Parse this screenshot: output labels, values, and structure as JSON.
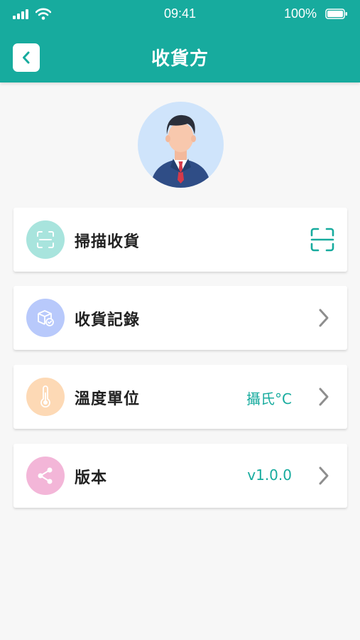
{
  "status_bar": {
    "time": "09:41",
    "battery": "100%",
    "icons": [
      "signal-icon",
      "wifi-icon",
      "battery-icon"
    ]
  },
  "header": {
    "title": "收貨方",
    "back_icon": "chevron-left-icon"
  },
  "profile": {
    "avatar_icon": "user-avatar-icon"
  },
  "menu": [
    {
      "label": "掃描收貨",
      "value": "",
      "icon": "scan-icon",
      "icon_bg": "#a8e4dd",
      "action_icon": "scan-frame-icon"
    },
    {
      "label": "收貨記錄",
      "value": "",
      "icon": "package-check-icon",
      "icon_bg": "#b8c9fb",
      "action_icon": "chevron-right-icon"
    },
    {
      "label": "溫度單位",
      "value": "攝氏°C",
      "icon": "thermometer-icon",
      "icon_bg": "#fdd9b5",
      "action_icon": "chevron-right-icon"
    },
    {
      "label": "版本",
      "value": "v1.0.0",
      "icon": "share-icon",
      "icon_bg": "#f3b6d8",
      "action_icon": "chevron-right-icon"
    }
  ],
  "colors": {
    "primary": "#17ab9e",
    "background": "#f7f7f7",
    "text": "#222222",
    "chevron": "#8e8e8e"
  }
}
